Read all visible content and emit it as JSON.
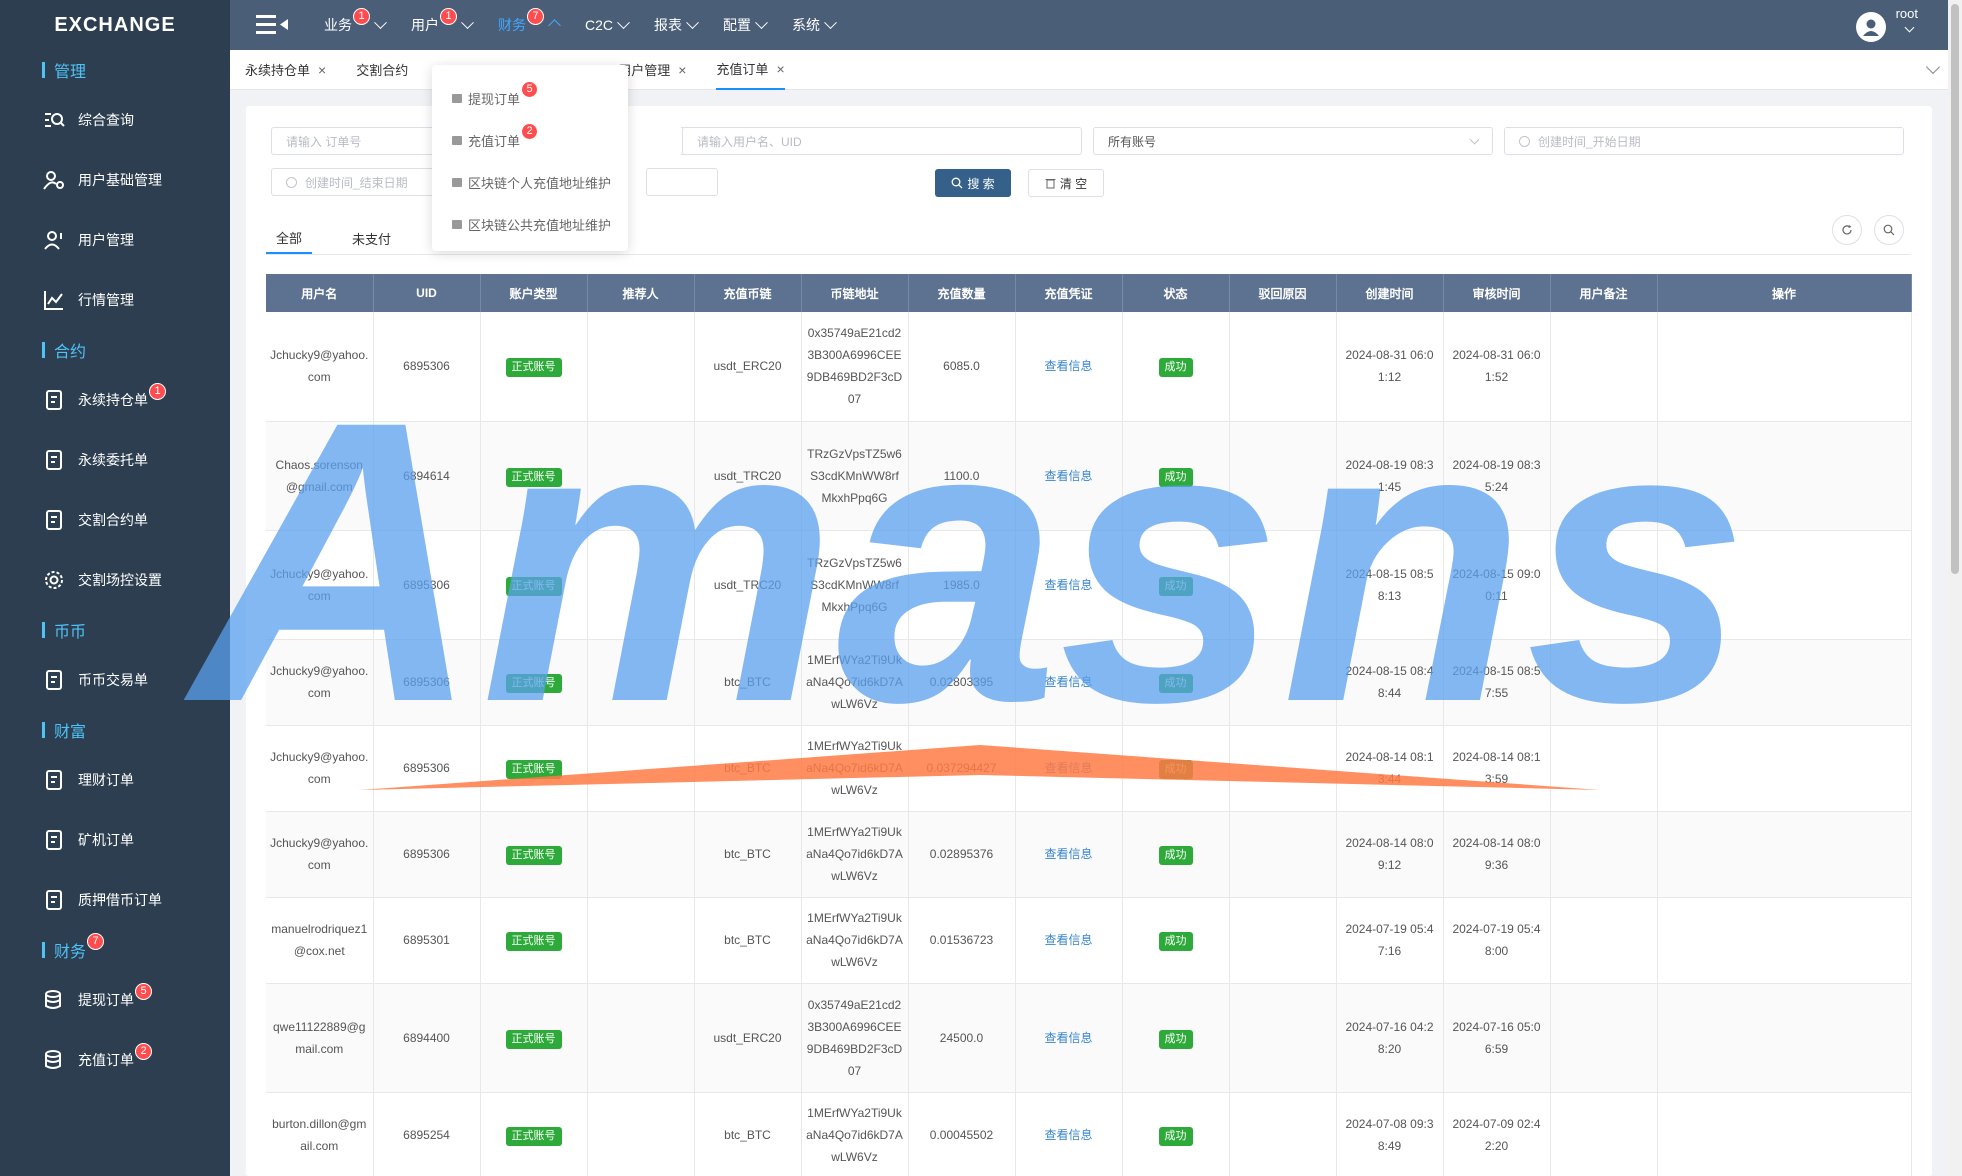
{
  "logo": "EXCHANGE",
  "sidebar": {
    "sections": [
      {
        "label": "管理",
        "items": [
          {
            "label": "综合查询",
            "icon": "search-list-icon"
          },
          {
            "label": "用户基础管理",
            "icon": "user-settings-icon"
          },
          {
            "label": "用户管理",
            "icon": "user-icon"
          },
          {
            "label": "行情管理",
            "icon": "line-chart-icon"
          }
        ]
      },
      {
        "label": "合约",
        "items": [
          {
            "label": "永续持仓单",
            "icon": "document-icon",
            "badge": "1"
          },
          {
            "label": "永续委托单",
            "icon": "document-icon"
          },
          {
            "label": "交割合约单",
            "icon": "document-icon"
          },
          {
            "label": "交割场控设置",
            "icon": "gear-icon"
          }
        ]
      },
      {
        "label": "币币",
        "items": [
          {
            "label": "币币交易单",
            "icon": "document-icon"
          }
        ]
      },
      {
        "label": "财富",
        "items": [
          {
            "label": "理财订单",
            "icon": "document-icon"
          },
          {
            "label": "矿机订单",
            "icon": "document-icon"
          },
          {
            "label": "质押借币订单",
            "icon": "document-icon"
          }
        ]
      },
      {
        "label": "财务",
        "badge": "7",
        "items": [
          {
            "label": "提现订单",
            "icon": "database-icon",
            "badge": "5"
          },
          {
            "label": "充值订单",
            "icon": "database-icon",
            "badge": "2"
          }
        ]
      }
    ]
  },
  "topnav": {
    "items": [
      {
        "label": "业务",
        "badge": "1"
      },
      {
        "label": "用户",
        "badge": "1"
      },
      {
        "label": "财务",
        "badge": "7",
        "active": true
      },
      {
        "label": "C2C"
      },
      {
        "label": "报表"
      },
      {
        "label": "配置"
      },
      {
        "label": "系统"
      }
    ],
    "username": "root"
  },
  "visited_tabs": [
    {
      "label": "永续持仓单"
    },
    {
      "label": "交割合约"
    },
    {
      "label": "用户管理"
    },
    {
      "label": "充值订单",
      "active": true
    }
  ],
  "dropdown": {
    "items": [
      {
        "label": "提现订单",
        "badge": "5"
      },
      {
        "label": "充值订单",
        "badge": "2"
      },
      {
        "label": "区块链个人充值地址维护"
      },
      {
        "label": "区块链公共充值地址维护"
      }
    ]
  },
  "filters": {
    "order_no_placeholder": "请输入 订单号",
    "user_placeholder": "请输入用户名、UID",
    "account_select": "所有账号",
    "start_date_placeholder": "创建时间_开始日期",
    "end_date_placeholder": "创建时间_结束日期",
    "search_label": "搜 索",
    "clear_label": "清 空"
  },
  "status_tabs": [
    {
      "label": "全部",
      "active": true
    },
    {
      "label": "未支付"
    }
  ],
  "table": {
    "headers": [
      "用户名",
      "UID",
      "账户类型",
      "推荐人",
      "充值币链",
      "币链地址",
      "充值数量",
      "充值凭证",
      "状态",
      "驳回原因",
      "创建时间",
      "审核时间",
      "用户备注",
      "操作"
    ],
    "rows": [
      {
        "user": "Jchucky9@yahoo.com",
        "uid": "6895306",
        "type": "正式账号",
        "ref": "",
        "chain": "usdt_ERC20",
        "addr": "0x35749aE21cd23B300A6996CEE9DB469BD2F3cD07",
        "amount": "6085.0",
        "proof": "查看信息",
        "status": "成功",
        "reason": "",
        "created": "2024-08-31 06:01:12",
        "audited": "2024-08-31 06:01:52",
        "note": "",
        "op": ""
      },
      {
        "user": "Chaos.sorenson@gmail.com",
        "uid": "6894614",
        "type": "正式账号",
        "ref": "",
        "chain": "usdt_TRC20",
        "addr": "TRzGzVpsTZ5w6S3cdKMnWW8rfMkxhPpq6G",
        "amount": "1100.0",
        "proof": "查看信息",
        "status": "成功",
        "reason": "",
        "created": "2024-08-19 08:31:45",
        "audited": "2024-08-19 08:35:24",
        "note": "",
        "op": ""
      },
      {
        "user": "Jchucky9@yahoo.com",
        "uid": "6895306",
        "type": "正式账号",
        "ref": "",
        "chain": "usdt_TRC20",
        "addr": "TRzGzVpsTZ5w6S3cdKMnWW8rfMkxhPpq6G",
        "amount": "1985.0",
        "proof": "查看信息",
        "status": "成功",
        "reason": "",
        "created": "2024-08-15 08:58:13",
        "audited": "2024-08-15 09:00:11",
        "note": "",
        "op": ""
      },
      {
        "user": "Jchucky9@yahoo.com",
        "uid": "6895306",
        "type": "正式账号",
        "ref": "",
        "chain": "btc_BTC",
        "addr": "1MErfWYa2Ti9UkaNa4Qo7id6kD7AwLW6Vz",
        "amount": "0.02803395",
        "proof": "查看信息",
        "status": "成功",
        "reason": "",
        "created": "2024-08-15 08:48:44",
        "audited": "2024-08-15 08:57:55",
        "note": "",
        "op": ""
      },
      {
        "user": "Jchucky9@yahoo.com",
        "uid": "6895306",
        "type": "正式账号",
        "ref": "",
        "chain": "btc_BTC",
        "addr": "1MErfWYa2Ti9UkaNa4Qo7id6kD7AwLW6Vz",
        "amount": "0.037294427",
        "proof": "查看信息",
        "status": "成功",
        "reason": "",
        "created": "2024-08-14 08:13:44",
        "audited": "2024-08-14 08:13:59",
        "note": "",
        "op": ""
      },
      {
        "user": "Jchucky9@yahoo.com",
        "uid": "6895306",
        "type": "正式账号",
        "ref": "",
        "chain": "btc_BTC",
        "addr": "1MErfWYa2Ti9UkaNa4Qo7id6kD7AwLW6Vz",
        "amount": "0.02895376",
        "proof": "查看信息",
        "status": "成功",
        "reason": "",
        "created": "2024-08-14 08:09:12",
        "audited": "2024-08-14 08:09:36",
        "note": "",
        "op": ""
      },
      {
        "user": "manuelrodriquez1@cox.net",
        "uid": "6895301",
        "type": "正式账号",
        "ref": "",
        "chain": "btc_BTC",
        "addr": "1MErfWYa2Ti9UkaNa4Qo7id6kD7AwLW6Vz",
        "amount": "0.01536723",
        "proof": "查看信息",
        "status": "成功",
        "reason": "",
        "created": "2024-07-19 05:47:16",
        "audited": "2024-07-19 05:48:00",
        "note": "",
        "op": ""
      },
      {
        "user": "qwe11122889@gmail.com",
        "uid": "6894400",
        "type": "正式账号",
        "ref": "",
        "chain": "usdt_ERC20",
        "addr": "0x35749aE21cd23B300A6996CEE9DB469BD2F3cD07",
        "amount": "24500.0",
        "proof": "查看信息",
        "status": "成功",
        "reason": "",
        "created": "2024-07-16 04:28:20",
        "audited": "2024-07-16 05:06:59",
        "note": "",
        "op": ""
      },
      {
        "user": "burton.dillon@gmail.com",
        "uid": "6895254",
        "type": "正式账号",
        "ref": "",
        "chain": "btc_BTC",
        "addr": "1MErfWYa2Ti9UkaNa4Qo7id6kD7AwLW6Vz",
        "amount": "0.00045502",
        "proof": "查看信息",
        "status": "成功",
        "reason": "",
        "created": "2024-07-08 09:38:49",
        "audited": "2024-07-09 02:42:20",
        "note": "",
        "op": ""
      }
    ]
  },
  "watermark": "Amasns",
  "colors": {
    "sidebar": "#2c3e50",
    "topbar": "#4a5e78",
    "accent": "#1890ff",
    "success": "#2eaa3a",
    "badge": "#ff4d4f",
    "table_header": "#5d7290"
  }
}
